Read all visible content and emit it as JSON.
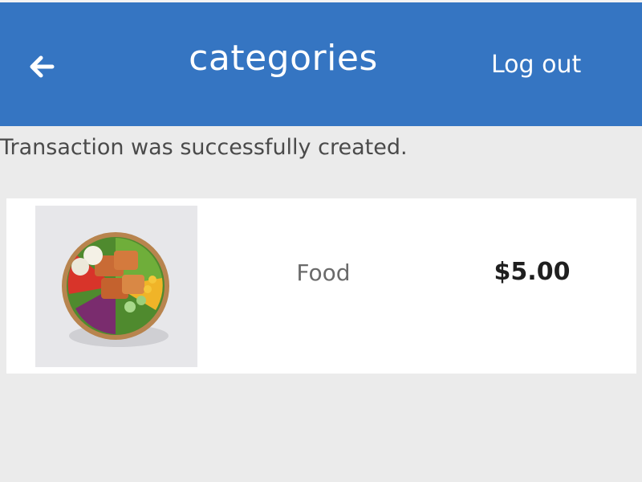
{
  "header": {
    "title": "categories",
    "logout_label": "Log out",
    "back_icon": "arrow-left-icon",
    "color": "#3575c2"
  },
  "notice": {
    "text": "Transaction was successfully created."
  },
  "transactions": [
    {
      "category": "Food",
      "amount": "$5.00",
      "image": "salad-bowl-image"
    }
  ]
}
